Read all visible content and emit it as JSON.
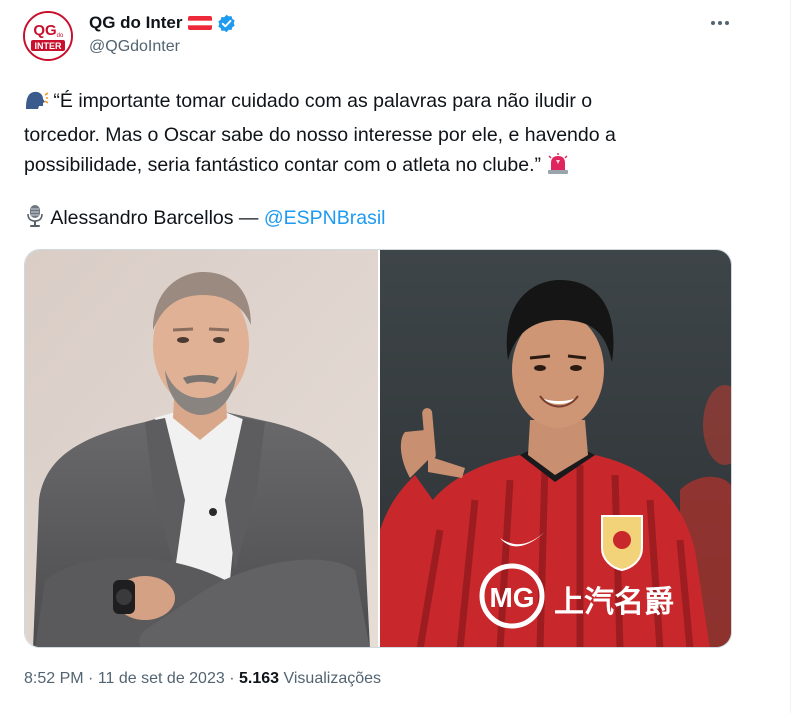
{
  "author": {
    "name": "QG do Inter",
    "handle": "@QGdoInter",
    "avatar_text_top": "QG",
    "avatar_text_small": "do",
    "avatar_text_bottom": "INTER",
    "flag_icon": "austria-flag-icon",
    "verified_icon": "verified-badge-icon"
  },
  "more_icon": "more-horizontal-icon",
  "tweet": {
    "quote_emoji": "🗣️",
    "line1": "“É importante tomar cuidado com as palavras para não iludir o",
    "line2": "torcedor. Mas o Oscar sabe do nosso interesse por ele, e havendo a",
    "line3": "possibilidade, seria fantástico contar com o atleta no clube.”",
    "alert_emoji": "🚨",
    "mic_emoji": "🎙️",
    "credit_name": "Alessandro Barcellos —",
    "credit_mention": "@ESPNBrasil"
  },
  "media": {
    "left_image": "alessandro-barcellos-photo",
    "right_image": "oscar-player-photo",
    "jersey_text": "上汽名爵",
    "jersey_logo": "MG"
  },
  "meta": {
    "time": "8:52 PM",
    "date": "11 de set de 2023",
    "views_count": "5.163",
    "views_label": "Visualizações",
    "separator": "·"
  },
  "colors": {
    "accent": "#1d9bf0",
    "text": "#0f1419",
    "secondary_text": "#536471",
    "brand_red": "#c8102e"
  }
}
